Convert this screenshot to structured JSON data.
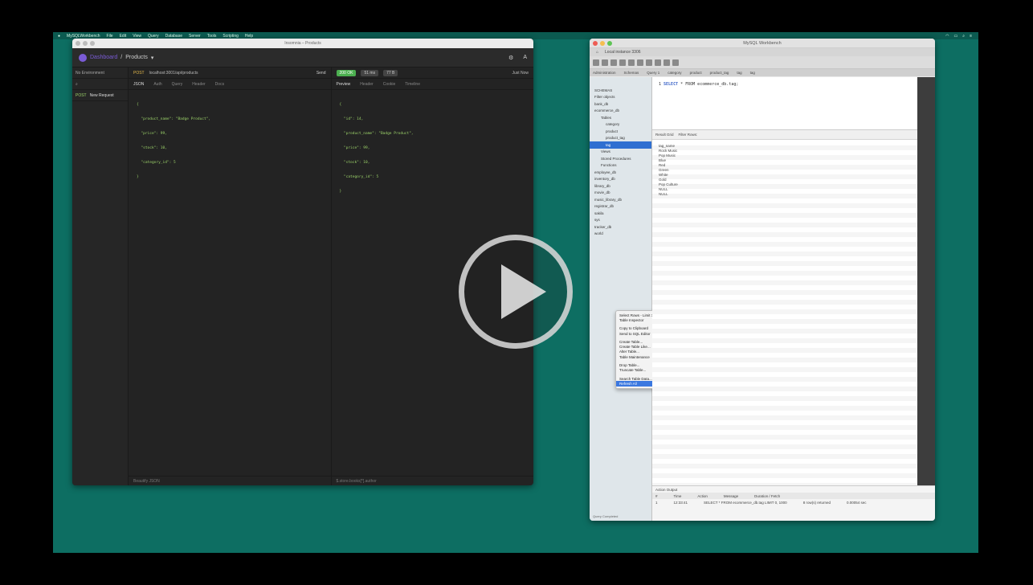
{
  "video": {
    "play_label": "Play"
  },
  "menubar": {
    "app": "MySQLWorkbench",
    "items": [
      "File",
      "Edit",
      "View",
      "Query",
      "Database",
      "Server",
      "Tools",
      "Scripting",
      "Help"
    ]
  },
  "insomnia": {
    "window_title": "Insomnia – Products",
    "dashboard": "Dashboard",
    "collection": "Products",
    "env": "No Environment",
    "cookies": "Cookies",
    "method": "POST",
    "url": "localhost:3001/api/products",
    "send": "Send",
    "request_tabs": [
      "JSON",
      "Auth",
      "Query",
      "Header",
      "Docs"
    ],
    "status": "200 OK",
    "time": "51 ms",
    "size": "77 B",
    "timeline_label": "Just Now",
    "response_tabs": [
      "Preview",
      "Header",
      "Cookie",
      "Timeline"
    ],
    "sidebar_item_method": "POST",
    "sidebar_item": "New Request",
    "request_body": [
      "{",
      "  \"product_name\": \"Badge Product\",",
      "  \"price\": 99,",
      "  \"stock\": 10,",
      "  \"category_id\": 5",
      "}"
    ],
    "response_body": [
      "{",
      "  \"id\": 14,",
      "  \"product_name\": \"Badge Product\",",
      "  \"price\": 99,",
      "  \"stock\": 10,",
      "  \"category_id\": 5",
      "}"
    ],
    "footer_left": "Beautify JSON",
    "footer_right": "$.store.books[*].author"
  },
  "workbench": {
    "window_title": "MySQL Workbench",
    "conn_tab": "Local instance 3306",
    "top_tabs": [
      "Administration",
      "Schemas",
      "Query 1",
      "category",
      "product",
      "product_tag",
      "tag",
      "tag"
    ],
    "sql_line_no": "1",
    "sql_keyword": "SELECT",
    "sql_rest": "* FROM ecommerce_db.tag;",
    "grid_toolbar": "Result Grid",
    "grid_filter": "Filter Rows:",
    "grid_cells": [
      "tag_name",
      "Rock Music",
      "Pop Music",
      "Blue",
      "Red",
      "Green",
      "White",
      "Gold",
      "Pop Culture",
      "NULL",
      "NULL"
    ],
    "nav_header": "SCHEMAS",
    "nav_search": "Filter objects",
    "nav_items": [
      "bank_db",
      "ecommerce_db",
      "Tables",
      "category",
      "product",
      "product_tag",
      "tag",
      "Views",
      "Stored Procedures",
      "Functions",
      "employee_db",
      "inventory_db",
      "library_db",
      "movie_db",
      "music_library_db",
      "registrar_db",
      "sakila",
      "sys",
      "tracker_db",
      "world"
    ],
    "selected_nav": "tag",
    "context_menu": [
      "Select Rows - Limit 1000",
      "Table Inspector",
      "Copy to Clipboard",
      "Send to SQL Editor",
      "Create Table...",
      "Create Table Like...",
      "Alter Table...",
      "Table Maintenance",
      "Drop Table...",
      "Truncate Table...",
      "Search Table Data...",
      "Refresh All"
    ],
    "selected_context": "Refresh All",
    "output_label": "Action Output",
    "output_headers": [
      "#",
      "Time",
      "Action",
      "Message",
      "Duration / Fetch"
    ],
    "output_row": [
      "1",
      "12:33:41",
      "SELECT * FROM ecommerce_db.tag LIMIT 0, 1000",
      "8 row(s) returned",
      "0.00054 sec"
    ],
    "status": "Query Completed"
  }
}
